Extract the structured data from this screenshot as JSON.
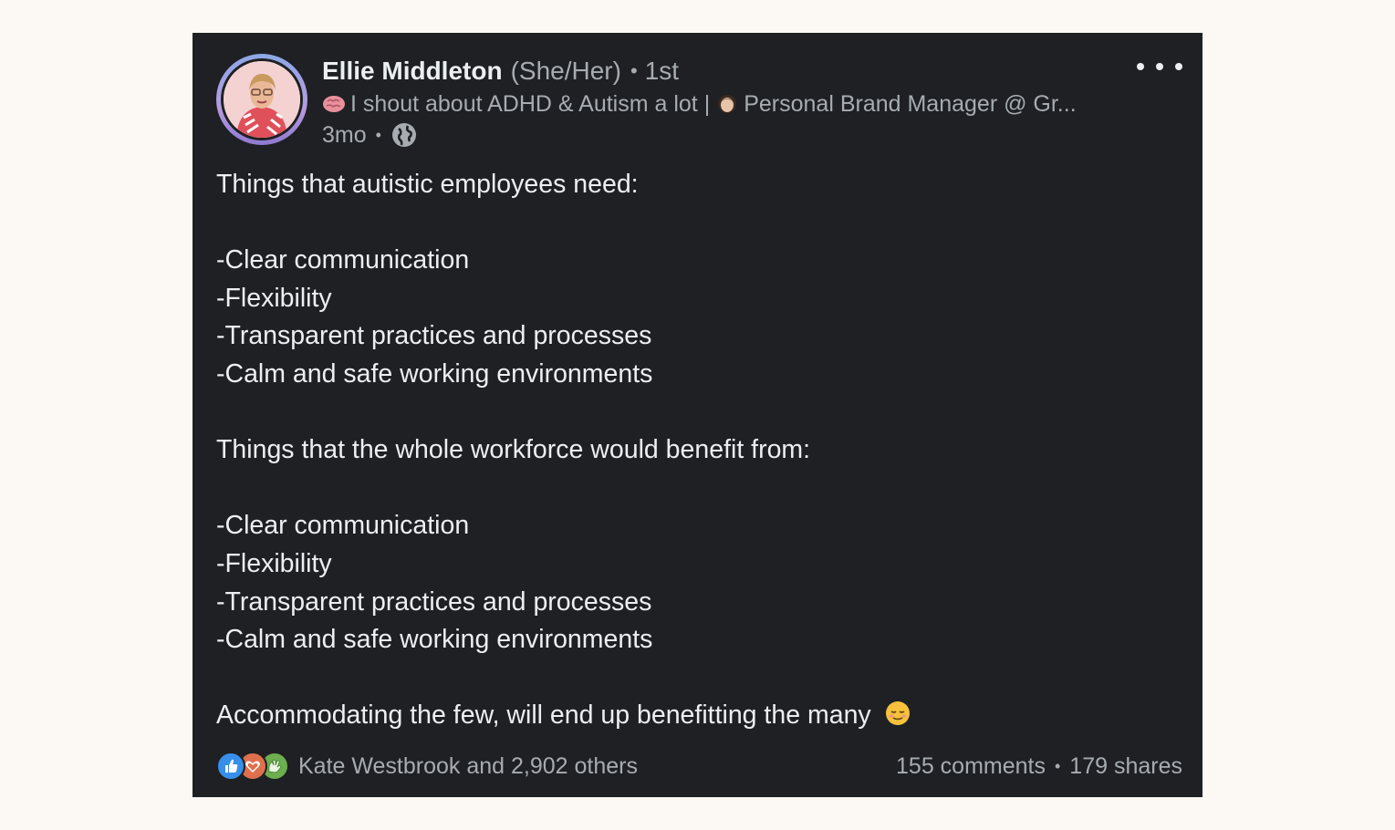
{
  "post": {
    "author": {
      "name": "Ellie Middleton",
      "pronouns": "(She/Her)",
      "connection_degree": "1st",
      "headline": "I shout about ADHD & Autism a lot | ",
      "headline_role": "Personal Brand Manager @ Gr...",
      "headline_icons": [
        "brain-emoji-icon",
        "woman-emoji-icon"
      ]
    },
    "time": "3mo",
    "visibility_icon": "globe-icon",
    "body_lines": [
      "Things that autistic employees need:",
      "",
      "-Clear communication",
      "-Flexibility",
      "-Transparent practices and processes",
      "-Calm and safe working environments",
      "",
      "Things that the whole workforce would benefit from:",
      "",
      "-Clear communication",
      "-Flexibility",
      "-Transparent practices and processes",
      "-Calm and safe working environments",
      "",
      "Accommodating the few, will end up benefitting the many"
    ],
    "body_end_emoji": "relieved-face-emoji",
    "reactions": {
      "icons": [
        "like-icon",
        "love-icon",
        "celebrate-icon"
      ],
      "reactors_text": "Kate Westbrook and 2,902 others"
    },
    "comments": "155 comments",
    "shares": "179 shares"
  },
  "colors": {
    "page_background": "#fcf9f5",
    "card_background": "#1e2023",
    "primary_text": "#eceff2",
    "secondary_text": "#a7acb1",
    "like": "#378fe9",
    "love": "#df704d",
    "celebrate": "#6dae4f"
  }
}
